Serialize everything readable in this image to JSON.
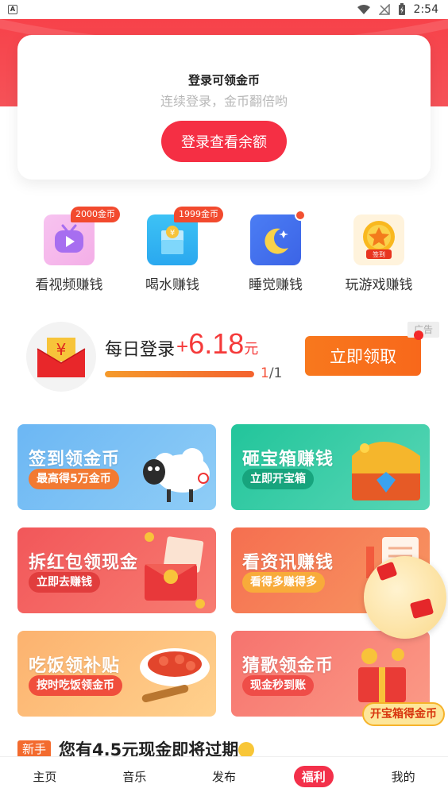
{
  "status_bar": {
    "time": "2:54",
    "left_icon_letter": "A"
  },
  "login_card": {
    "title": "登录可领金币",
    "subtitle": "连续登录，金币翻倍哟",
    "button": "登录查看余额"
  },
  "earn_items": [
    {
      "label": "看视频赚钱",
      "badge": "2000金币",
      "icon": "video-tv-icon"
    },
    {
      "label": "喝水赚钱",
      "badge": "1999金币",
      "icon": "water-glass-icon"
    },
    {
      "label": "睡觉赚钱",
      "badge": "",
      "icon": "moon-sleep-icon"
    },
    {
      "label": "玩游戏赚钱",
      "badge": "",
      "icon": "star-game-icon",
      "icon_text": "签到"
    }
  ],
  "daily": {
    "label": "每日登录",
    "plus": "+",
    "amount": "6.18",
    "unit": "元",
    "progress_current": "1",
    "progress_total": "/1",
    "progress_fraction": 1,
    "button": "立即领取",
    "ad_tag": "广告"
  },
  "cards": [
    {
      "title": "签到领金币",
      "pill": "最高得5万金币",
      "art": "sheep"
    },
    {
      "title": "砸宝箱赚钱",
      "pill": "立即开宝箱",
      "art": "treasure-chest"
    },
    {
      "title": "拆红包领现金",
      "pill": "立即去赚钱",
      "art": "red-packet"
    },
    {
      "title": "看资讯赚钱",
      "pill": "看得多赚得多",
      "art": "news-scroll"
    },
    {
      "title": "吃饭领补贴",
      "pill": "按时吃饭领金币",
      "art": "crayfish-plate"
    },
    {
      "title": "猜歌领金币",
      "pill": "现金秒到账",
      "art": "gift-box"
    }
  ],
  "float_widget": {
    "label": "开宝箱得金币"
  },
  "notice": {
    "tag": "新手",
    "text": "您有4.5元现金即将过期"
  },
  "tabs": [
    {
      "label": "主页",
      "active": false
    },
    {
      "label": "音乐",
      "active": false
    },
    {
      "label": "发布",
      "active": false
    },
    {
      "label": "福利",
      "active": true
    },
    {
      "label": "我的",
      "active": false
    }
  ]
}
